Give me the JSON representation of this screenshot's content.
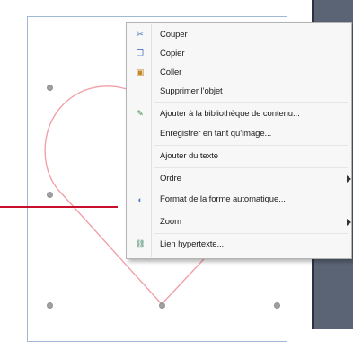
{
  "context_menu": {
    "items": [
      {
        "label": "Couper",
        "icon": "scissors-icon",
        "icon_glyph": "✂",
        "icon_color": "#3f6fb5",
        "submenu": false
      },
      {
        "label": "Copier",
        "icon": "copy-icon",
        "icon_glyph": "❐",
        "icon_color": "#4a78c0",
        "submenu": false
      },
      {
        "label": "Coller",
        "icon": "paste-icon",
        "icon_glyph": "▣",
        "icon_color": "#c48a2a",
        "submenu": false
      },
      {
        "label": "Supprimer l’objet",
        "icon": "",
        "icon_glyph": "",
        "icon_color": "",
        "submenu": false
      },
      {
        "label": "Ajouter à la bibliothèque de contenu...",
        "icon": "library-icon",
        "icon_glyph": "✎",
        "icon_color": "#3d8a3d",
        "submenu": false
      },
      {
        "label": "Enregistrer en tant qu’image...",
        "icon": "",
        "icon_glyph": "",
        "icon_color": "",
        "submenu": false
      },
      {
        "label": "Ajouter du texte",
        "icon": "",
        "icon_glyph": "",
        "icon_color": "",
        "submenu": false
      },
      {
        "label": "Ordre",
        "icon": "",
        "icon_glyph": "",
        "icon_color": "",
        "submenu": true
      },
      {
        "label": "Format de la forme automatique...",
        "icon": "format-shape-icon",
        "icon_glyph": "◐",
        "icon_color": "#4a78c0",
        "submenu": false
      },
      {
        "label": "Zoom",
        "icon": "",
        "icon_glyph": "",
        "icon_color": "",
        "submenu": true
      },
      {
        "label": "Lien hypertexte...",
        "icon": "hyperlink-icon",
        "icon_glyph": "⛓",
        "icon_color": "#2f7a5a",
        "submenu": false
      }
    ]
  },
  "colors": {
    "selection_handle": "#a0a0a0",
    "shape_stroke": "#f0a0a8",
    "callout_line": "#c8102e",
    "page_border": "#9fb8d8",
    "side_panel": "#5b6475"
  }
}
